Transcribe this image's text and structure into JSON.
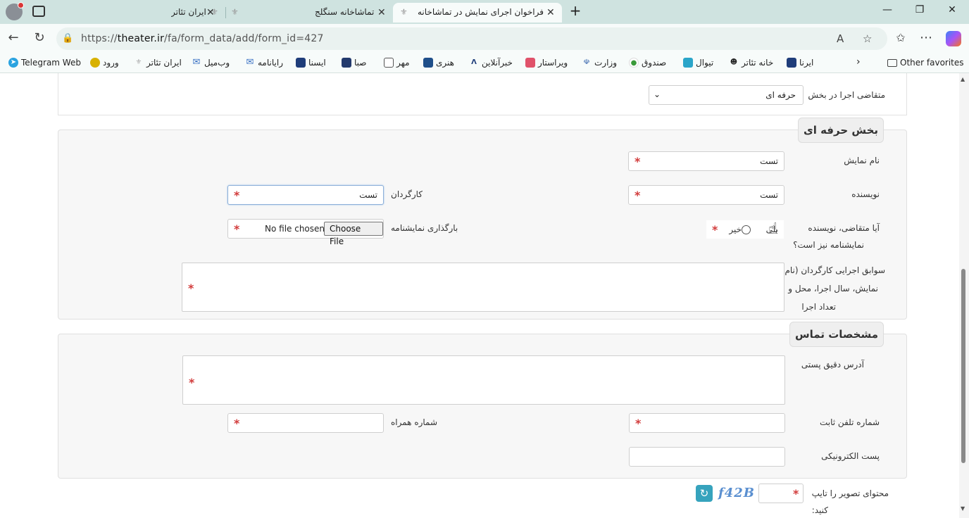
{
  "browser": {
    "tabs": [
      {
        "label": "ایران تئاتر",
        "active": false
      },
      {
        "label": "تماشاخانه سنگلج",
        "active": false
      },
      {
        "label": "فراخوان اجرای نمایش در تماشاخانه",
        "active": true
      }
    ],
    "url_prefix": "https://",
    "url_domain": "theater.ir",
    "url_path": "/fa/form_data/add/form_id=427",
    "bookmarks": [
      "Telegram Web",
      "ورود",
      "ایران تئاتر",
      "وب‌میل",
      "رایانامه",
      "ایسنا",
      "صبا",
      "مهر",
      "هنری",
      "خبرآنلاین",
      "ویراستار",
      "وزارت",
      "صندوق",
      "تیوال",
      "خانه تئاتر",
      "ایرنا"
    ],
    "other_favorites": "Other favorites"
  },
  "form": {
    "section_select": {
      "label": "متقاضی اجرا در بخش",
      "value": "حرفه ای"
    },
    "professional": {
      "legend": "بخش حرفه ای",
      "show_name": {
        "label": "نام نمایش",
        "value": "تست"
      },
      "writer": {
        "label": "نویسنده",
        "value": "تست"
      },
      "director": {
        "label": "کارگردان",
        "value": "تست"
      },
      "is_writer_q1": "آیا متقاضی، نویسنده",
      "is_writer_q2": "نمایشنامه نیز است؟",
      "yes": "بلی",
      "no": "خیر",
      "upload_label": "بارگذاری نمایشنامه",
      "choose_file": "Choose File",
      "no_file": "No file chosen",
      "history_l1": "سوابق اجرایی کارگردان (نام",
      "history_l2": "نمایش، سال اجرا، محل و",
      "history_l3": "تعداد اجرا"
    },
    "contact": {
      "legend": "مشخصات تماس",
      "address_label": "آدرس دقیق پستی",
      "phone_label": "شماره تلفن ثابت",
      "mobile_label": "شماره همراه",
      "email_label": "پست الکترونیکی"
    },
    "captcha": {
      "label1": "محتوای تصویر را تایپ",
      "label2": "کنید:",
      "code": "f42B"
    }
  }
}
